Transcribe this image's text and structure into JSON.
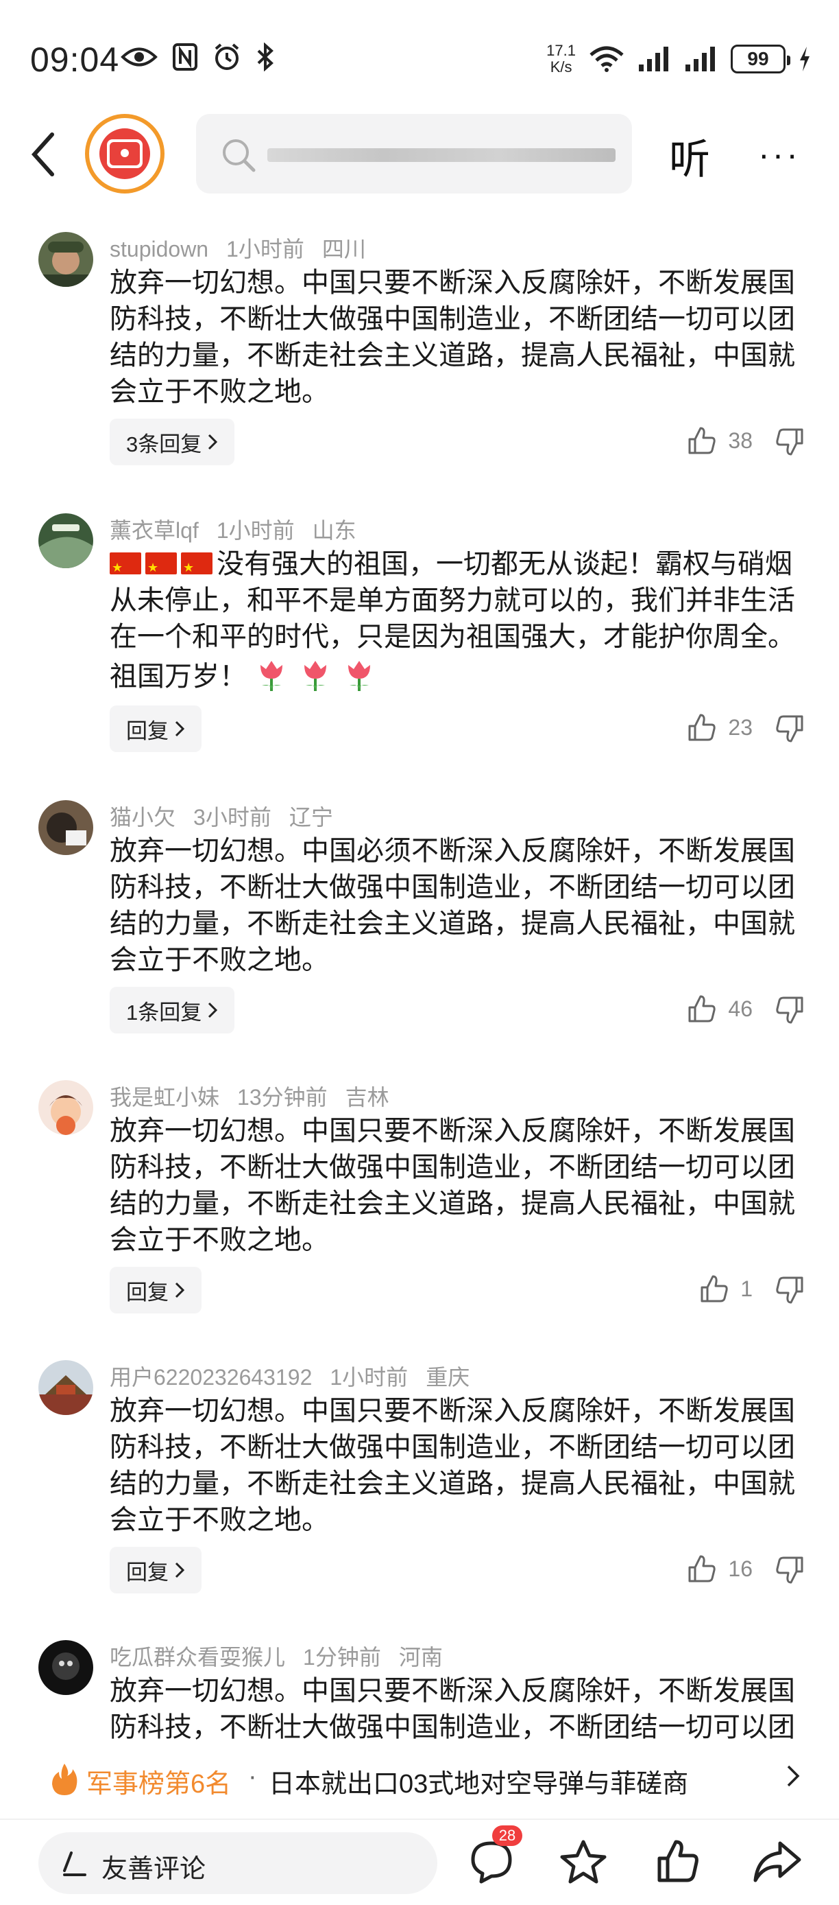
{
  "status_bar": {
    "time": "09:04",
    "net_speed_value": "17.1",
    "net_speed_unit": "K/s",
    "battery": "99"
  },
  "top_nav": {
    "listen_label": "听",
    "more_label": "···"
  },
  "comments": [
    {
      "user": "stupidown",
      "time": "1小时前",
      "location": "四川",
      "text": "放弃一切幻想。中国只要不断深入反腐除奸，不断发展国防科技，不断壮大做强中国制造业，不断团结一切可以团结的力量，不断走社会主义道路，提高人民福祉，中国就会立于不败之地。",
      "reply_label": "3条回复",
      "likes": "38"
    },
    {
      "user": "薰衣草lqf",
      "time": "1小时前",
      "location": "山东",
      "text": "没有强大的祖国，一切都无从谈起！霸权与硝烟从未停止，和平不是单方面努力就可以的，我们并非生活在一个和平的时代，只是因为祖国强大，才能护你周全。祖国万岁！",
      "reply_label": "回复",
      "likes": "23"
    },
    {
      "user": "猫小欠",
      "time": "3小时前",
      "location": "辽宁",
      "text": "放弃一切幻想。中国必须不断深入反腐除奸，不断发展国防科技，不断壮大做强中国制造业，不断团结一切可以团结的力量，不断走社会主义道路，提高人民福祉，中国就会立于不败之地。",
      "reply_label": "1条回复",
      "likes": "46"
    },
    {
      "user": "我是虹小妹",
      "time": "13分钟前",
      "location": "吉林",
      "text": "放弃一切幻想。中国只要不断深入反腐除奸，不断发展国防科技，不断壮大做强中国制造业，不断团结一切可以团结的力量，不断走社会主义道路，提高人民福祉，中国就会立于不败之地。",
      "reply_label": "回复",
      "likes": "1"
    },
    {
      "user": "用户6220232643192",
      "time": "1小时前",
      "location": "重庆",
      "text": "放弃一切幻想。中国只要不断深入反腐除奸，不断发展国防科技，不断壮大做强中国制造业，不断团结一切可以团结的力量，不断走社会主义道路，提高人民福祉，中国就会立于不败之地。",
      "reply_label": "回复",
      "likes": "16"
    },
    {
      "user": "吃瓜群众看耍猴儿",
      "time": "1分钟前",
      "location": "河南",
      "text": "放弃一切幻想。中国只要不断深入反腐除奸，不断发展国防科技，不断壮大做强中国制造业，不断团结一切可以团",
      "reply_label": "",
      "likes": ""
    }
  ],
  "hot_bar": {
    "rank": "军事榜第6名",
    "separator": "·",
    "title": "日本就出口03式地对空导弹与菲磋商"
  },
  "bottom_bar": {
    "input_placeholder": "友善评论",
    "comment_count_badge": "28"
  },
  "colors": {
    "accent_orange": "#f28a2e",
    "badge_red": "#f03e3e",
    "logo_red": "#e8413b",
    "meta_gray": "#9a9a9a"
  },
  "icons": [
    "back-arrow-icon",
    "search-icon",
    "like-icon",
    "dislike-icon",
    "fire-icon",
    "chevron-right-icon",
    "pen-icon",
    "comment-icon",
    "star-icon",
    "share-icon"
  ]
}
